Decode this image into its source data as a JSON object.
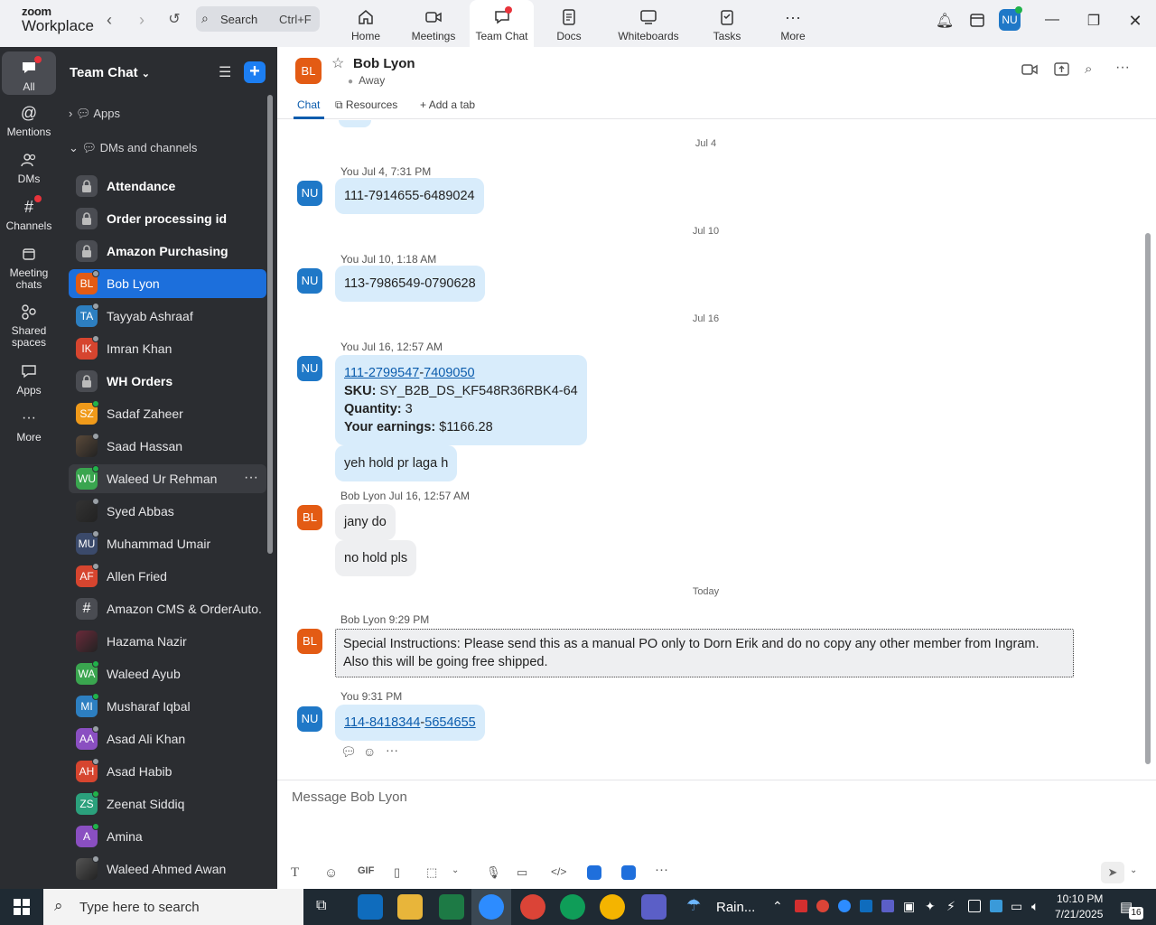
{
  "app": {
    "brand_small": "zoom",
    "brand_big": "Workplace"
  },
  "search": {
    "placeholder": "Search",
    "shortcut": "Ctrl+F"
  },
  "top_tabs": [
    {
      "label": "Home"
    },
    {
      "label": "Meetings"
    },
    {
      "label": "Team Chat"
    },
    {
      "label": "Docs"
    },
    {
      "label": "Whiteboards"
    },
    {
      "label": "Tasks"
    },
    {
      "label": "More"
    }
  ],
  "user": {
    "initials": "NU"
  },
  "rail": [
    {
      "label": "All"
    },
    {
      "label": "Mentions"
    },
    {
      "label": "DMs"
    },
    {
      "label": "Channels"
    },
    {
      "label": "Meeting chats"
    },
    {
      "label": "Shared spaces"
    },
    {
      "label": "Apps"
    },
    {
      "label": "More"
    }
  ],
  "sidebar": {
    "title": "Team Chat",
    "sections": [
      {
        "label": "Apps"
      },
      {
        "label": "DMs and channels"
      }
    ],
    "items": [
      {
        "initials": "",
        "name": "Attendance",
        "color": "#4a4c52",
        "lock": true,
        "bold": true
      },
      {
        "initials": "",
        "name": "Order processing id",
        "color": "#4a4c52",
        "lock": true,
        "bold": true
      },
      {
        "initials": "",
        "name": "Amazon Purchasing",
        "color": "#4a4c52",
        "lock": true,
        "bold": true
      },
      {
        "initials": "BL",
        "name": "Bob Lyon",
        "color": "#e35b14",
        "status": "away",
        "selected": true
      },
      {
        "initials": "TA",
        "name": "Tayyab Ashraaf",
        "color": "#2d7fc1",
        "status": "away"
      },
      {
        "initials": "IK",
        "name": "Imran Khan",
        "color": "#d6452f",
        "status": "away"
      },
      {
        "initials": "",
        "name": "WH Orders",
        "color": "#4a4c52",
        "lock": true,
        "bold": true
      },
      {
        "initials": "SZ",
        "name": "Sadaf Zaheer",
        "color": "#f09a1a",
        "status": "online"
      },
      {
        "initials": "",
        "name": "Saad Hassan",
        "color": "#5b4a3a",
        "status": "away",
        "photo": true
      },
      {
        "initials": "WU",
        "name": "Waleed Ur Rehman",
        "color": "#3aa54f",
        "status": "online",
        "hover": true
      },
      {
        "initials": "",
        "name": "Syed Abbas",
        "color": "#333",
        "status": "away",
        "photo": true
      },
      {
        "initials": "MU",
        "name": "Muhammad Umair",
        "color": "#3b4a6b",
        "status": "away"
      },
      {
        "initials": "AF",
        "name": "Allen Fried",
        "color": "#d6452f",
        "status": "away"
      },
      {
        "initials": "#",
        "name": "Amazon CMS & OrderAuto...",
        "color": "#4a4c52",
        "channel": true
      },
      {
        "initials": "",
        "name": "Hazama Nazir",
        "color": "#6b2a3a",
        "status": "",
        "photo": true
      },
      {
        "initials": "WA",
        "name": "Waleed Ayub",
        "color": "#3aa54f",
        "status": "online"
      },
      {
        "initials": "MI",
        "name": "Musharaf Iqbal",
        "color": "#2d7fc1",
        "status": "mobile"
      },
      {
        "initials": "AA",
        "name": "Asad Ali Khan",
        "color": "#8a4fc1",
        "status": "away"
      },
      {
        "initials": "AH",
        "name": "Asad Habib",
        "color": "#d6452f",
        "status": "away"
      },
      {
        "initials": "ZS",
        "name": "Zeenat Siddiq",
        "color": "#2ba07c",
        "status": "online"
      },
      {
        "initials": "A",
        "name": "Amina",
        "color": "#8a4fc1",
        "status": "mobile"
      },
      {
        "initials": "",
        "name": "Waleed Ahmed Awan",
        "color": "#555",
        "status": "away",
        "photo": true
      }
    ]
  },
  "chat": {
    "name": "Bob Lyon",
    "initials": "BL",
    "status": "Away",
    "tabs": {
      "chat": "Chat",
      "resources": "Resources",
      "add": "Add a tab"
    },
    "dates": [
      "Jul 4",
      "Jul 10",
      "Jul 16",
      "Today"
    ],
    "messages": [
      {
        "meta": "You Jul 4, 7:31 PM",
        "text": "111-7914655-6489024"
      },
      {
        "meta": "You Jul 10, 1:18 AM",
        "text": "113-7986549-0790628"
      },
      {
        "meta": "You Jul 16, 12:57 AM",
        "link1": "111-2799547",
        "link2": "7409050",
        "sku_label": "SKU:",
        "sku": "SY_B2B_DS_KF548R36RBK4-64",
        "qty_label": "Quantity:",
        "qty": "3",
        "earn_label": "Your earnings:",
        "earn": "$1166.28",
        "followup": "yeh hold pr laga h"
      },
      {
        "sender": "Bob Lyon",
        "time": "Jul 16, 12:57 AM",
        "text1": "jany do",
        "text2": "no hold pls"
      },
      {
        "sender": "Bob Lyon",
        "time": "9:29 PM",
        "line1": "Special Instructions: Please send this as a manual PO only to Dorn Erik and do no copy any other member from Ingram.",
        "line2": "Also this will be going free shipped."
      },
      {
        "meta": "You 9:31 PM",
        "link1": "114-8418344",
        "link2": "5654655"
      }
    ],
    "composer_placeholder": "Message Bob Lyon"
  },
  "taskbar": {
    "search": "Type here to search",
    "weather": "Rain...",
    "time": "10:10 PM",
    "date": "7/21/2025",
    "notif": "16"
  }
}
